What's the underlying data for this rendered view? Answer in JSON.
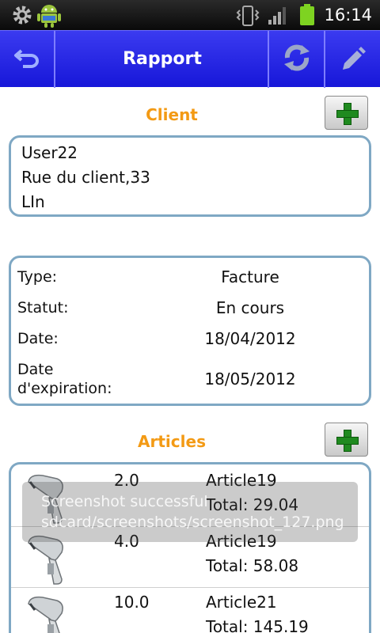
{
  "status_bar": {
    "time": "16:14",
    "icons": [
      "settings-icon",
      "android-debug-icon",
      "vibrate-icon",
      "signal-icon",
      "battery-icon"
    ]
  },
  "title_bar": {
    "title": "Rapport",
    "icons": [
      "back-icon",
      "sync-icon",
      "edit-icon"
    ]
  },
  "client": {
    "section_title": "Client",
    "lines": [
      "User22",
      "Rue du client,33",
      "LIn"
    ]
  },
  "info": {
    "rows": [
      {
        "label": "Type:",
        "value": "Facture"
      },
      {
        "label": "Statut:",
        "value": "En cours"
      },
      {
        "label": "Date:",
        "value": "18/04/2012"
      },
      {
        "label": "Date\nd'expiration:",
        "value": "18/05/2012"
      }
    ]
  },
  "articles": {
    "section_title": "Articles",
    "items": [
      {
        "qty": "2.0",
        "name": "Article19",
        "total": "Total: 29.04"
      },
      {
        "qty": "4.0",
        "name": "Article19",
        "total": "Total: 58.08"
      },
      {
        "qty": "10.0",
        "name": "Article21",
        "total": "Total: 145.19"
      }
    ]
  },
  "toast": {
    "line1": "Screenshot successful",
    "line2": "sdcard/screenshots/screenshot_127.png"
  },
  "colors": {
    "title_bar": "#2323e0",
    "section_title": "#f39a14",
    "box_border": "#7fa8c4",
    "add_plus": "#1f8a1f"
  }
}
